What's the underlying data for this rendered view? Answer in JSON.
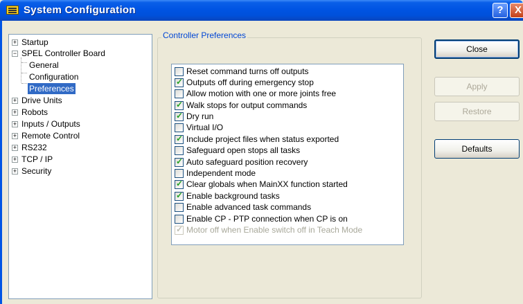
{
  "window": {
    "title": "System Configuration",
    "help_label": "?",
    "close_label": "X"
  },
  "tree": {
    "items": [
      {
        "label": "Startup",
        "expander": "+"
      },
      {
        "label": "SPEL Controller Board",
        "expander": "−"
      },
      {
        "label": "General"
      },
      {
        "label": "Configuration"
      },
      {
        "label": "Preferences",
        "selected": true
      },
      {
        "label": "Drive Units",
        "expander": "+"
      },
      {
        "label": "Robots",
        "expander": "+"
      },
      {
        "label": "Inputs / Outputs",
        "expander": "+"
      },
      {
        "label": "Remote Control",
        "expander": "+"
      },
      {
        "label": "RS232",
        "expander": "+"
      },
      {
        "label": "TCP / IP",
        "expander": "+"
      },
      {
        "label": "Security",
        "expander": "+"
      }
    ]
  },
  "group": {
    "title": "Controller Preferences",
    "options": [
      {
        "label": "Reset command turns off outputs",
        "checked": false
      },
      {
        "label": "Outputs off during emergency stop",
        "checked": true
      },
      {
        "label": "Allow motion with one or more joints free",
        "checked": false
      },
      {
        "label": "Walk stops for output commands",
        "checked": true
      },
      {
        "label": "Dry run",
        "checked": true
      },
      {
        "label": "Virtual I/O",
        "checked": false
      },
      {
        "label": "Include project files when status exported",
        "checked": true
      },
      {
        "label": "Safeguard open stops all tasks",
        "checked": false
      },
      {
        "label": "Auto safeguard position recovery",
        "checked": true
      },
      {
        "label": "Independent mode",
        "checked": false
      },
      {
        "label": "Clear globals when MainXX function started",
        "checked": true
      },
      {
        "label": "Enable background tasks",
        "checked": true
      },
      {
        "label": "Enable advanced task commands",
        "checked": false
      },
      {
        "label": "Enable CP - PTP connection when CP is on",
        "checked": false
      },
      {
        "label": "Motor off when Enable switch off in Teach Mode",
        "checked": true,
        "disabled": true
      }
    ]
  },
  "buttons": {
    "close": "Close",
    "apply": "Apply",
    "restore": "Restore",
    "defaults": "Defaults"
  }
}
